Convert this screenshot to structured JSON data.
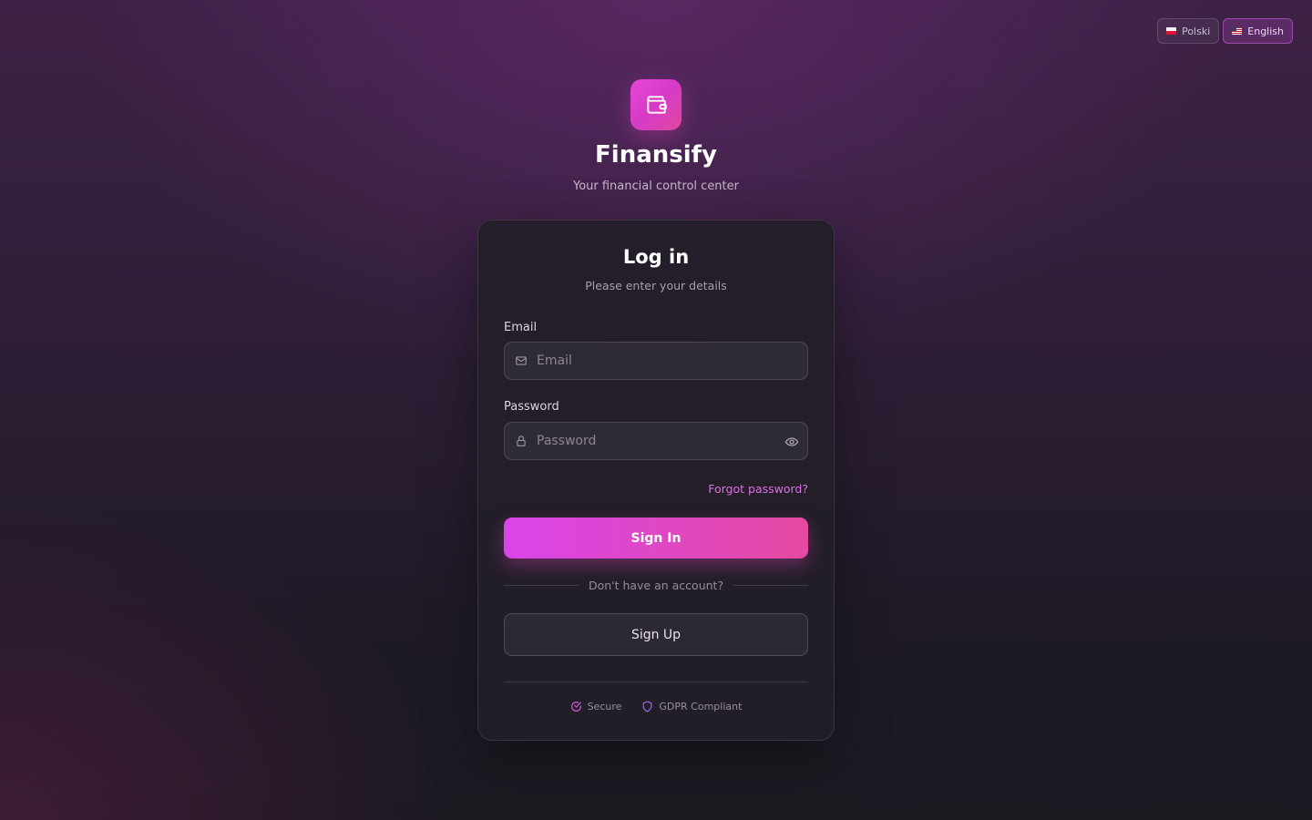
{
  "language_switcher": {
    "options": [
      {
        "label": "Polski",
        "active": false
      },
      {
        "label": "English",
        "active": true
      }
    ]
  },
  "brand": {
    "name": "Finansify",
    "tagline": "Your financial control center",
    "logo_icon": "wallet-icon"
  },
  "login_card": {
    "title": "Log in",
    "subtitle": "Please enter your details",
    "email": {
      "label": "Email",
      "placeholder": "Email",
      "value": "",
      "icon": "mail-icon"
    },
    "password": {
      "label": "Password",
      "placeholder": "Password",
      "value": "",
      "icon": "lock-icon",
      "toggle_icon": "eye-icon"
    },
    "forgot_password": "Forgot password?",
    "sign_in_label": "Sign In",
    "divider_text": "Don't have an account?",
    "sign_up_label": "Sign Up",
    "badges": [
      {
        "label": "Secure",
        "icon": "check-circle-icon"
      },
      {
        "label": "GDPR Compliant",
        "icon": "shield-icon"
      }
    ]
  },
  "colors": {
    "accent": "#d945ea",
    "accent_end": "#e54aa0",
    "link": "#dd6fe6"
  }
}
